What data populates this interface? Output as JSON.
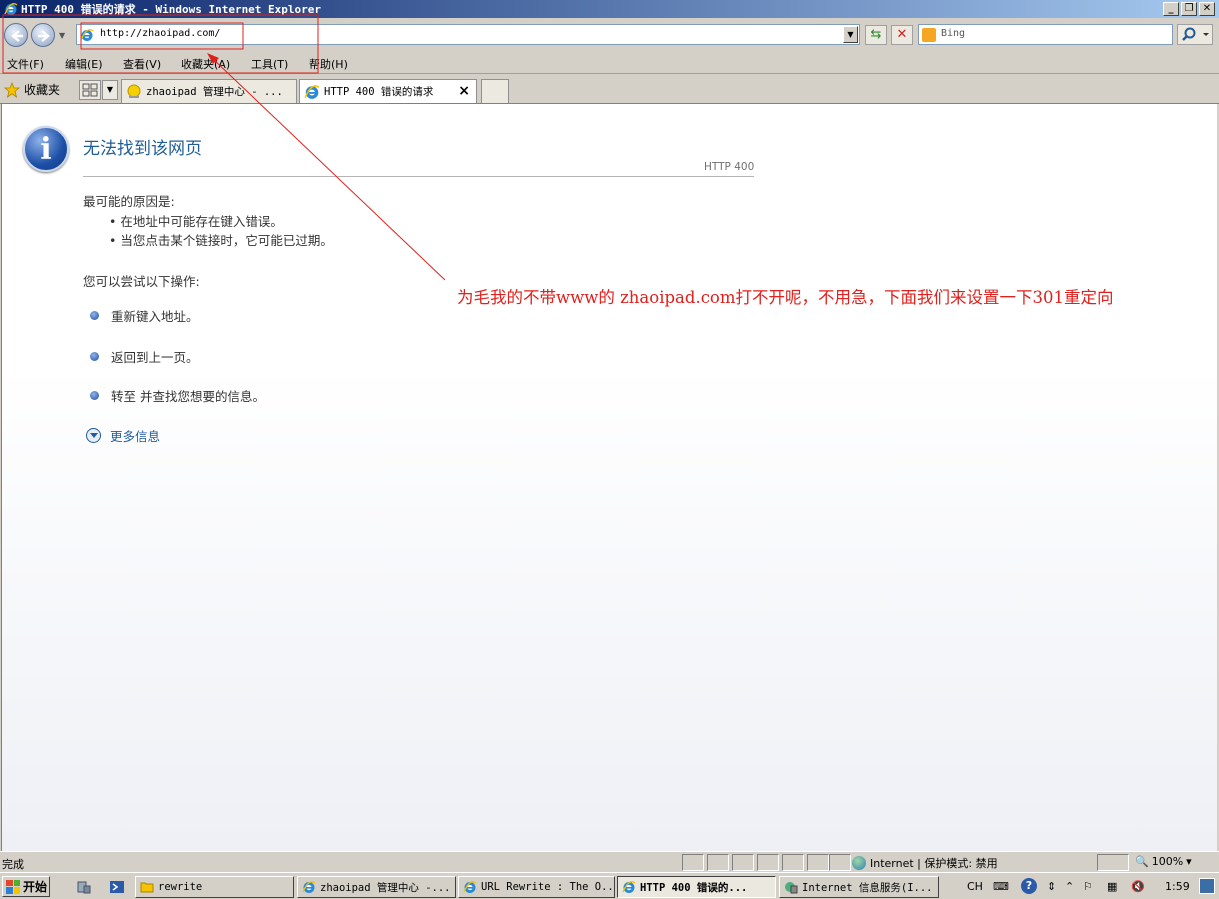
{
  "window": {
    "title": "HTTP 400 错误的请求 - Windows Internet Explorer",
    "controls": [
      "_",
      "❐",
      "✕"
    ]
  },
  "address": {
    "url": "http://zhaoipad.com/",
    "search_placeholder": "Bing"
  },
  "menu": {
    "items": [
      "文件(F)",
      "编辑(E)",
      "查看(V)",
      "收藏夹(A)",
      "工具(T)",
      "帮助(H)"
    ]
  },
  "tabs": {
    "favorites_label": "收藏夹",
    "items": [
      {
        "title": "zhaoipad 管理中心 - ..."
      },
      {
        "title": "HTTP 400 错误的请求",
        "close": "×"
      }
    ]
  },
  "page": {
    "heading": "无法找到该网页",
    "http_code": "HTTP 400",
    "reason_title": "最可能的原因是:",
    "reasons": [
      "•  在地址中可能存在键入错误。",
      "•  当您点击某个链接时，它可能已过期。"
    ],
    "try_title": "您可以尝试以下操作:",
    "actions": [
      "重新键入地址。",
      "返回到上一页。",
      "转至  并查找您想要的信息。"
    ],
    "more_info": "更多信息"
  },
  "annotation": {
    "text": "为毛我的不带www的 zhaoipad.com打不开呢，不用急，下面我们来设置一下301重定向",
    "color": "#e0201c"
  },
  "statusbar": {
    "status": "完成",
    "zone": "Internet | 保护模式: 禁用",
    "zoom": "100%"
  },
  "taskbar": {
    "start_label": "开始",
    "buttons": [
      {
        "label": "rewrite"
      },
      {
        "label": "zhaoipad 管理中心 -..."
      },
      {
        "label": "URL Rewrite : The O..."
      },
      {
        "label": "HTTP 400 错误的..."
      },
      {
        "label": "Internet 信息服务(I..."
      }
    ],
    "lang": "CH",
    "clock": "1:59"
  }
}
